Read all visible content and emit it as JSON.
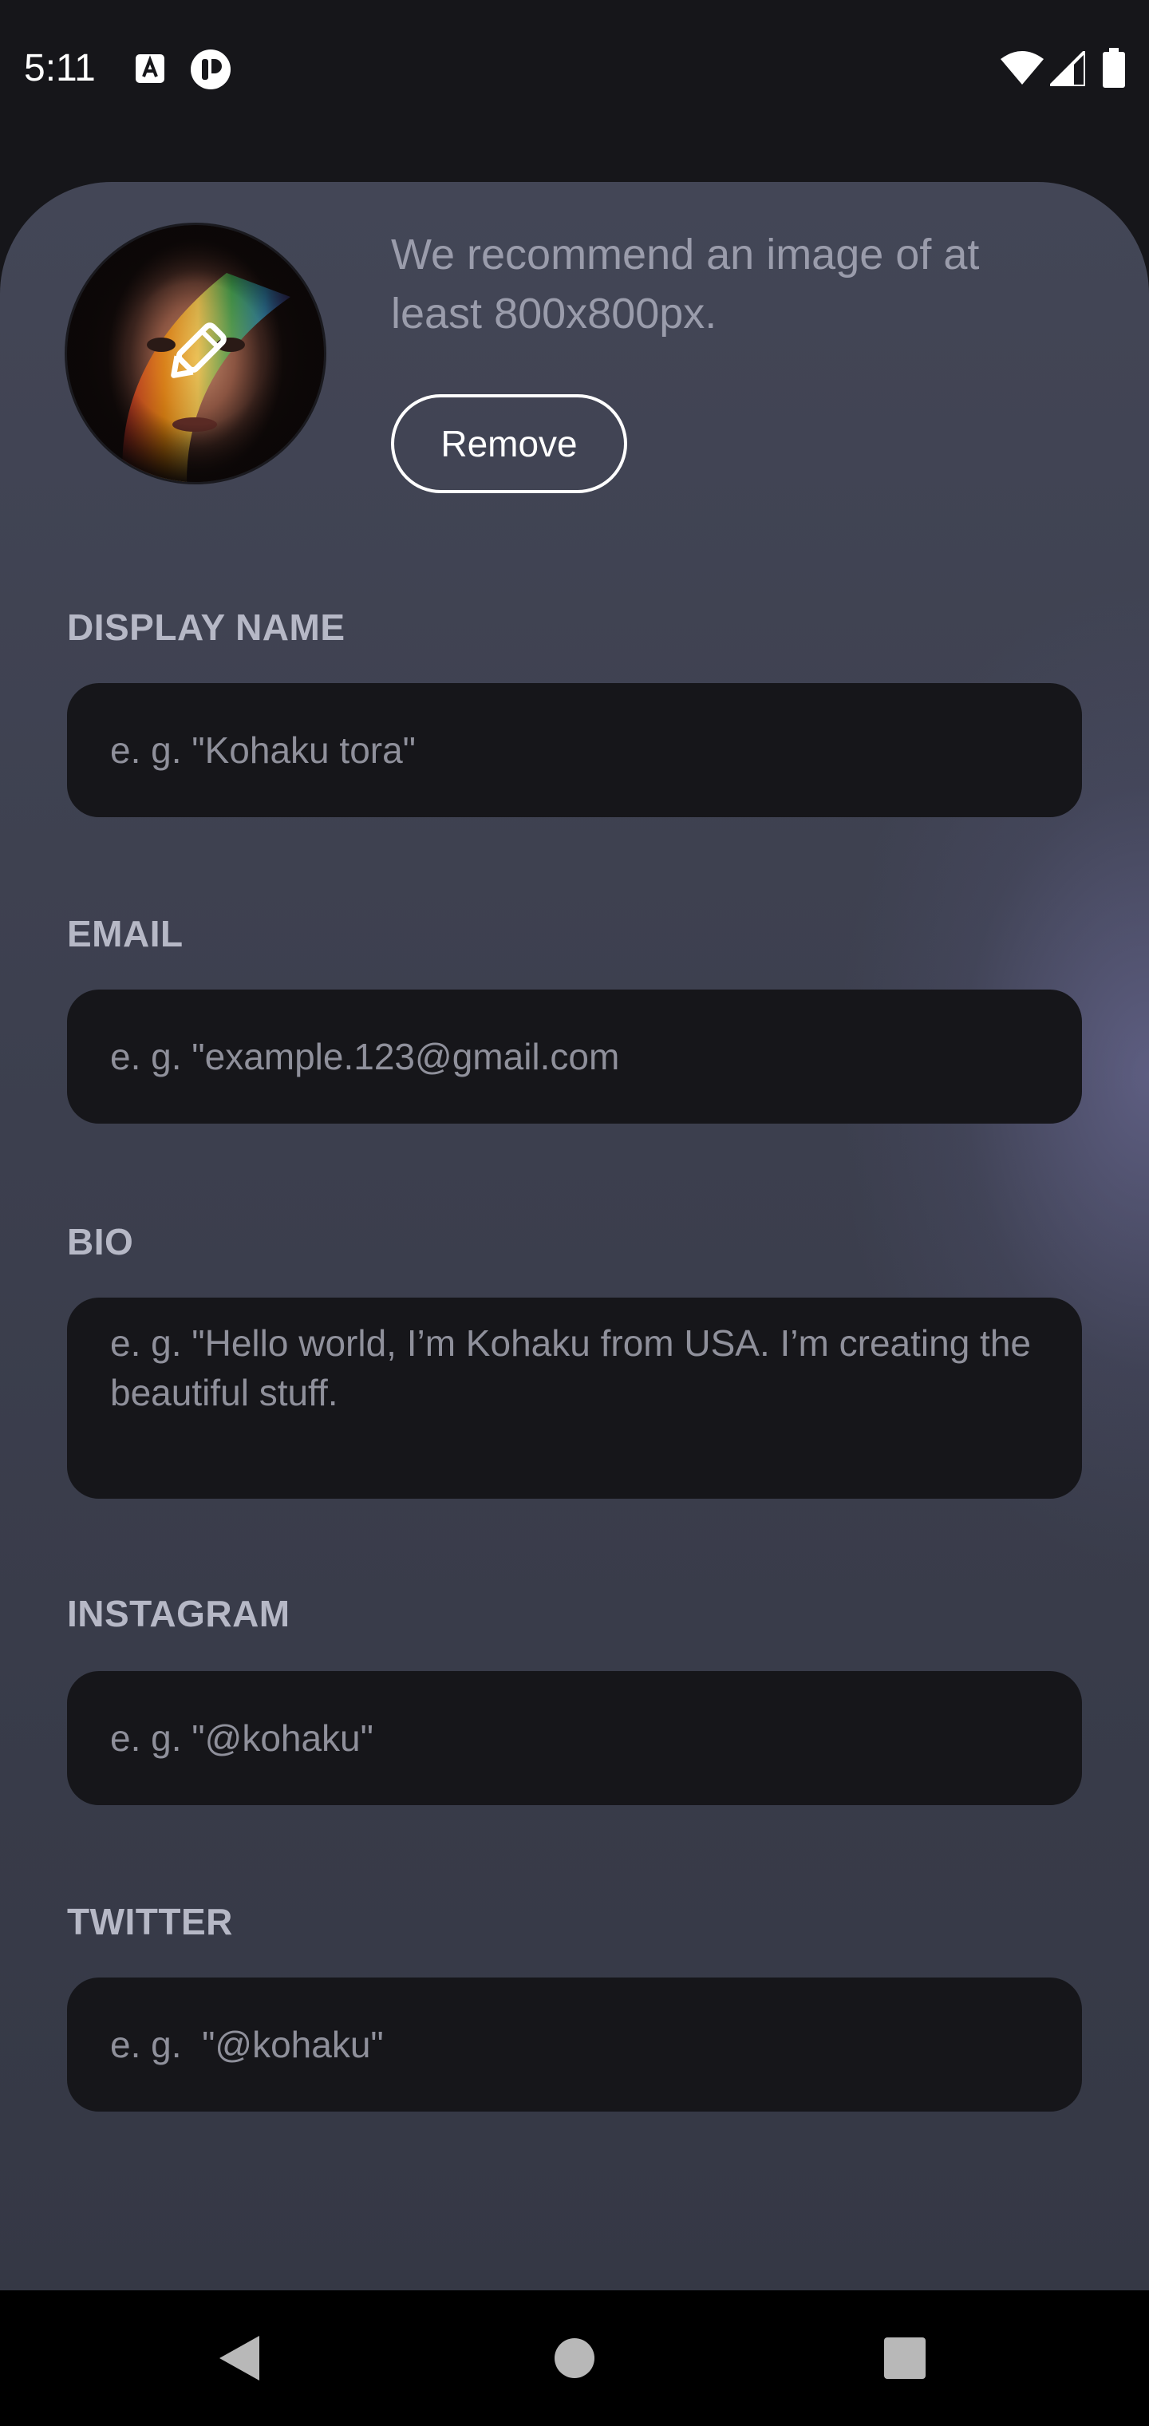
{
  "status_bar": {
    "time": "5:11",
    "icons": [
      "app-notification-icon",
      "notification-icon",
      "wifi-icon",
      "signal-icon",
      "battery-icon"
    ]
  },
  "profile": {
    "recommendation": "We recommend an image of at least 800x800px.",
    "remove_label": "Remove",
    "avatar_icon": "edit-pencil-icon"
  },
  "form": {
    "display_name": {
      "label": "DISPLAY NAME",
      "placeholder": "e. g. \"Kohaku tora\"",
      "value": ""
    },
    "email": {
      "label": "EMAIL",
      "placeholder": "e. g. \"example.123@gmail.com",
      "value": ""
    },
    "bio": {
      "label": "BIO",
      "placeholder": "e. g. \"Hello world, I’m Kohaku from USA. I’m creating the beautiful stuff.",
      "value": ""
    },
    "instagram": {
      "label": "INSTAGRAM",
      "placeholder": "e. g. \"@kohaku\"",
      "value": ""
    },
    "twitter": {
      "label": "TWITTER",
      "placeholder": "e. g.  \"@kohaku\"",
      "value": ""
    }
  },
  "nav_bar": {
    "icons": [
      "back-icon",
      "home-icon",
      "recents-icon"
    ]
  },
  "colors": {
    "background": "#16161a",
    "sheet": "#3c3f4e",
    "input_fill": "#16161a",
    "label": "#b6b8c6",
    "placeholder": "#8f909b",
    "accent_text": "#ffffff"
  }
}
